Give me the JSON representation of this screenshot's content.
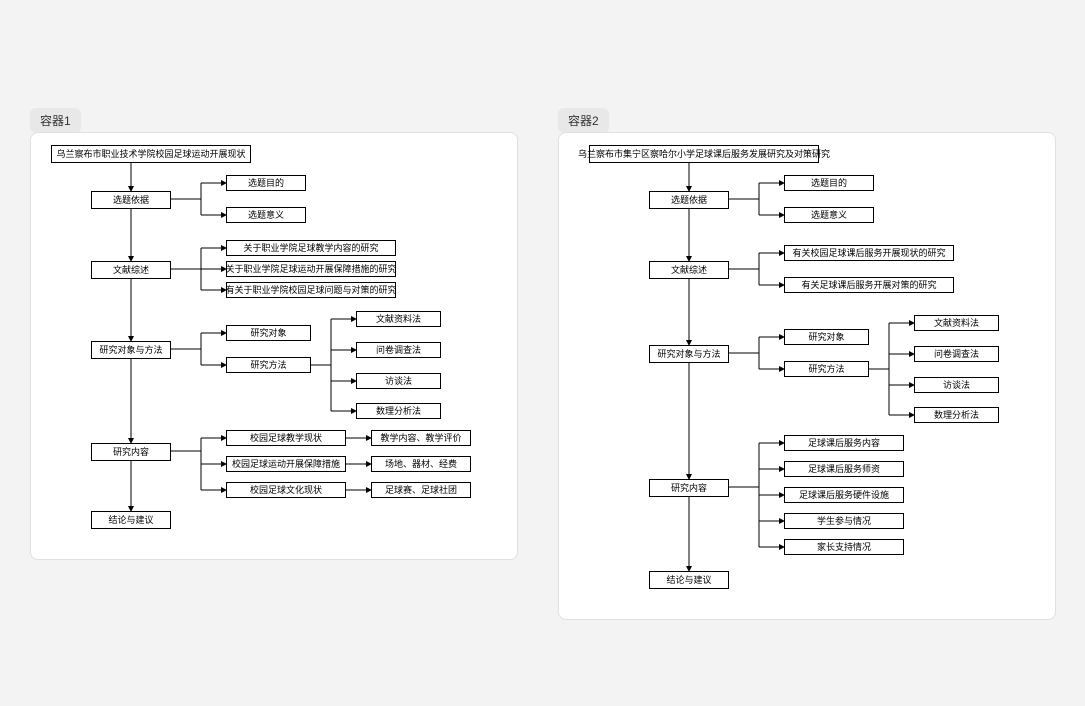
{
  "labels": {
    "container1": "容器1",
    "container2": "容器2"
  },
  "c1": {
    "title": "乌兰察布市职业技术学院校园足球运动开展现状",
    "xuanti": "选题依据",
    "xuanti_mudi": "选题目的",
    "xuanti_yiyi": "选题意义",
    "wenxian": "文献综述",
    "wx1": "关于职业学院足球教学内容的研究",
    "wx2": "关于职业学院足球运动开展保障措施的研究",
    "wx3": "有关于职业学院校园足球问题与对策的研究",
    "duixiang_fangfa": "研究对象与方法",
    "duixiang": "研究对象",
    "fangfa": "研究方法",
    "m1": "文献资料法",
    "m2": "问卷调查法",
    "m3": "访谈法",
    "m4": "数理分析法",
    "neirong": "研究内容",
    "nr1": "校园足球教学现状",
    "nr2": "校园足球运动开展保障措施",
    "nr3": "校园足球文化现状",
    "nr1r": "教学内容、教学评价",
    "nr2r": "场地、器材、经费",
    "nr3r": "足球赛、足球社团",
    "jielun": "结论与建议"
  },
  "c2": {
    "title": "乌兰察布市集宁区察哈尔小学足球课后服务发展研究及对策研究",
    "xuanti": "选题依据",
    "xuanti_mudi": "选题目的",
    "xuanti_yiyi": "选题意义",
    "wenxian": "文献综述",
    "wx1": "有关校园足球课后服务开展现状的研究",
    "wx2": "有关足球课后服务开展对策的研究",
    "duixiang_fangfa": "研究对象与方法",
    "duixiang": "研究对象",
    "fangfa": "研究方法",
    "m1": "文献资料法",
    "m2": "问卷调查法",
    "m3": "访谈法",
    "m4": "数理分析法",
    "neirong": "研究内容",
    "nr1": "足球课后服务内容",
    "nr2": "足球课后服务师资",
    "nr3": "足球课后服务硬件设施",
    "nr4": "学生参与情况",
    "nr5": "家长支持情况",
    "jielun": "结论与建议"
  }
}
